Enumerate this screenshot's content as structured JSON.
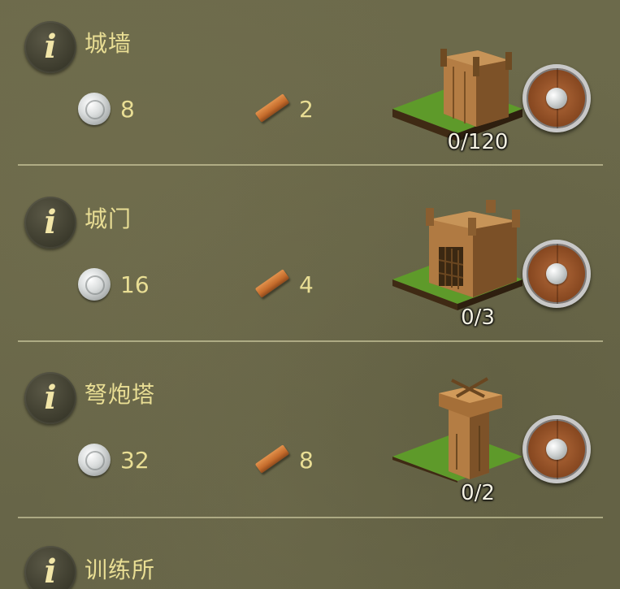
{
  "items": [
    {
      "name": "城墙",
      "coin_cost": "8",
      "wood_cost": "2",
      "count": "0/120",
      "building": "wall"
    },
    {
      "name": "城门",
      "coin_cost": "16",
      "wood_cost": "4",
      "count": "0/3",
      "building": "gate"
    },
    {
      "name": "弩炮塔",
      "coin_cost": "32",
      "wood_cost": "8",
      "count": "0/2",
      "building": "ballista-tower"
    },
    {
      "name": "训练所"
    }
  ],
  "icons": {
    "info": "info-icon",
    "coin": "silver-coin-icon",
    "wood": "wood-plank-icon",
    "shield": "shield-icon"
  },
  "colors": {
    "background": "#6c6a4b",
    "label_text": "#e9de94",
    "info_letter": "#f2e6a8"
  }
}
